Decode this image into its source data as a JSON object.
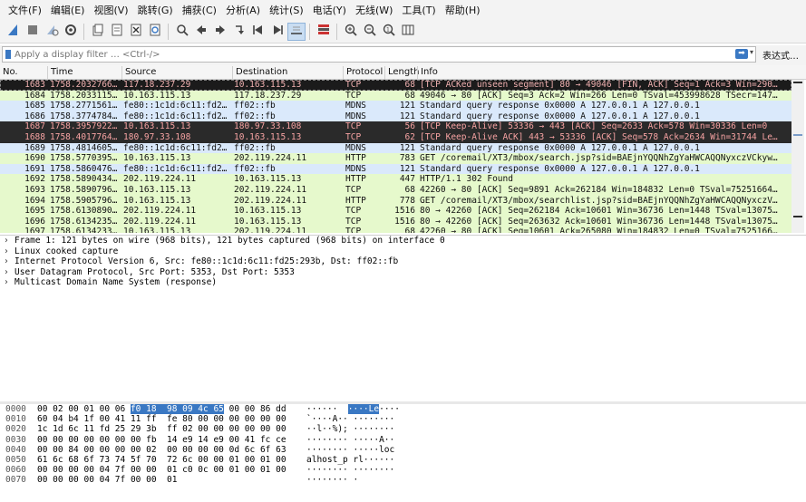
{
  "menu": [
    "文件(F)",
    "编辑(E)",
    "视图(V)",
    "跳转(G)",
    "捕获(C)",
    "分析(A)",
    "统计(S)",
    "电话(Y)",
    "无线(W)",
    "工具(T)",
    "帮助(H)"
  ],
  "toolbar_icons": [
    "shark-fin-start-icon",
    "stop-icon",
    "restart-icon",
    "options-gear-icon",
    "open-file-icon",
    "save-file-icon",
    "close-file-icon",
    "reload-icon",
    "find-icon",
    "back-arrow-icon",
    "forward-arrow-icon",
    "go-to-packet-icon",
    "first-packet-icon",
    "last-packet-icon",
    "autoscroll-icon",
    "colorize-icon",
    "zoom-in-icon",
    "zoom-out-icon",
    "normal-size-icon",
    "resize-columns-icon"
  ],
  "filter": {
    "placeholder": "Apply a display filter … <Ctrl-/>",
    "apply_arrow": "➡",
    "dropdown": "▾",
    "expression_label": "表达式…"
  },
  "columns": [
    "No.",
    "Time",
    "Source",
    "Destination",
    "Protocol",
    "Length",
    "Info"
  ],
  "colors": {
    "dark_bg": "#2a2a2a",
    "dark_fg": "#f7a3a3",
    "selected_bg": "#1b1b1b",
    "selected_fg": "#f0b0b0",
    "tcp_bg": "#e6f9cc",
    "http_bg": "#e6f9cc",
    "mdns_bg": "#dae9fb",
    "selection_blue": "#3a78c3"
  },
  "packets": [
    {
      "no": "1683",
      "time": "1758.2032766…",
      "src": "117.18.237.29",
      "dst": "10.163.115.13",
      "proto": "TCP",
      "len": "68",
      "info": "[TCP ACKed unseen segment] 80 → 49046 [FIN, ACK] Seq=1 Ack=3 Win=290…",
      "style": "selected"
    },
    {
      "no": "1684",
      "time": "1758.2033115…",
      "src": "10.163.115.13",
      "dst": "117.18.237.29",
      "proto": "TCP",
      "len": "68",
      "info": "49046 → 80 [ACK] Seq=3 Ack=2 Win=266 Len=0 TSval=453998628 TSecr=147…",
      "style": "tcp"
    },
    {
      "no": "1685",
      "time": "1758.2771561…",
      "src": "fe80::1c1d:6c11:fd2…",
      "dst": "ff02::fb",
      "proto": "MDNS",
      "len": "121",
      "info": "Standard query response 0x0000 A 127.0.0.1 A 127.0.0.1",
      "style": "mdns"
    },
    {
      "no": "1686",
      "time": "1758.3774784…",
      "src": "fe80::1c1d:6c11:fd2…",
      "dst": "ff02::fb",
      "proto": "MDNS",
      "len": "121",
      "info": "Standard query response 0x0000 A 127.0.0.1 A 127.0.0.1",
      "style": "mdns"
    },
    {
      "no": "1687",
      "time": "1758.3957922…",
      "src": "10.163.115.13",
      "dst": "180.97.33.108",
      "proto": "TCP",
      "len": "56",
      "info": "[TCP Keep-Alive] 53336 → 443 [ACK] Seq=2633 Ack=578 Win=30336 Len=0",
      "style": "dark"
    },
    {
      "no": "1688",
      "time": "1758.4017764…",
      "src": "180.97.33.108",
      "dst": "10.163.115.13",
      "proto": "TCP",
      "len": "62",
      "info": "[TCP Keep-Alive ACK] 443 → 53336 [ACK] Seq=578 Ack=2634 Win=31744 Le…",
      "style": "dark"
    },
    {
      "no": "1689",
      "time": "1758.4814605…",
      "src": "fe80::1c1d:6c11:fd2…",
      "dst": "ff02::fb",
      "proto": "MDNS",
      "len": "121",
      "info": "Standard query response 0x0000 A 127.0.0.1 A 127.0.0.1",
      "style": "mdns"
    },
    {
      "no": "1690",
      "time": "1758.5770395…",
      "src": "10.163.115.13",
      "dst": "202.119.224.11",
      "proto": "HTTP",
      "len": "783",
      "info": "GET /coremail/XT3/mbox/search.jsp?sid=BAEjnYQQNhZgYaHWCAQQNyxczVCkyw…",
      "style": "tcp"
    },
    {
      "no": "1691",
      "time": "1758.5860476…",
      "src": "fe80::1c1d:6c11:fd2…",
      "dst": "ff02::fb",
      "proto": "MDNS",
      "len": "121",
      "info": "Standard query response 0x0000 A 127.0.0.1 A 127.0.0.1",
      "style": "mdns"
    },
    {
      "no": "1692",
      "time": "1758.5890434…",
      "src": "202.119.224.11",
      "dst": "10.163.115.13",
      "proto": "HTTP",
      "len": "447",
      "info": "HTTP/1.1 302 Found",
      "style": "tcp"
    },
    {
      "no": "1693",
      "time": "1758.5890796…",
      "src": "10.163.115.13",
      "dst": "202.119.224.11",
      "proto": "TCP",
      "len": "68",
      "info": "42260 → 80 [ACK] Seq=9891 Ack=262184 Win=184832 Len=0 TSval=75251664…",
      "style": "tcp"
    },
    {
      "no": "1694",
      "time": "1758.5905796…",
      "src": "10.163.115.13",
      "dst": "202.119.224.11",
      "proto": "HTTP",
      "len": "778",
      "info": "GET /coremail/XT3/mbox/searchlist.jsp?sid=BAEjnYQQNhZgYaHWCAQQNyxczV…",
      "style": "tcp"
    },
    {
      "no": "1695",
      "time": "1758.6130890…",
      "src": "202.119.224.11",
      "dst": "10.163.115.13",
      "proto": "TCP",
      "len": "1516",
      "info": "80 → 42260 [ACK] Seq=262184 Ack=10601 Win=36736 Len=1448 TSval=13075…",
      "style": "tcp"
    },
    {
      "no": "1696",
      "time": "1758.6134235…",
      "src": "202.119.224.11",
      "dst": "10.163.115.13",
      "proto": "TCP",
      "len": "1516",
      "info": "80 → 42260 [ACK] Seq=263632 Ack=10601 Win=36736 Len=1448 TSval=13075…",
      "style": "tcp"
    },
    {
      "no": "1697",
      "time": "1758.6134233…",
      "src": "10.163.115.13",
      "dst": "202.119.224.11",
      "proto": "TCP",
      "len": "68",
      "info": "42260 → 80 [ACK] Seq=10601 Ack=265080 Win=184832 Len=0 TSval=7525166…",
      "style": "tcp"
    }
  ],
  "details": [
    "Frame 1: 121 bytes on wire (968 bits), 121 bytes captured (968 bits) on interface 0",
    "Linux cooked capture",
    "Internet Protocol Version 6, Src: fe80::1c1d:6c11:fd25:293b, Dst: ff02::fb",
    "User Datagram Protocol, Src Port: 5353, Dst Port: 5353",
    "Multicast Domain Name System (response)"
  ],
  "hexdump": [
    {
      "off": "0000",
      "pre": "00 02 00 01 00 06 ",
      "hl": "f0 18  98 09 4c 65",
      "post": " 00 00 86 dd",
      "ascii_pre": "······  ",
      "ascii_hl": "····Le",
      "ascii_post": "····"
    },
    {
      "off": "0010",
      "pre": "60 04 b4 1f 00 41 11 ff  fe 80 00 00 00 00 00 00",
      "hl": "",
      "post": "",
      "ascii_pre": "`····A·· ········",
      "ascii_hl": "",
      "ascii_post": ""
    },
    {
      "off": "0020",
      "pre": "1c 1d 6c 11 fd 25 29 3b  ff 02 00 00 00 00 00 00",
      "hl": "",
      "post": "",
      "ascii_pre": "··l··%); ········",
      "ascii_hl": "",
      "ascii_post": ""
    },
    {
      "off": "0030",
      "pre": "00 00 00 00 00 00 00 fb  14 e9 14 e9 00 41 fc ce",
      "hl": "",
      "post": "",
      "ascii_pre": "········ ·····A··",
      "ascii_hl": "",
      "ascii_post": ""
    },
    {
      "off": "0040",
      "pre": "00 00 84 00 00 00 00 02  00 00 00 00 0d 6c 6f 63",
      "hl": "",
      "post": "",
      "ascii_pre": "········ ·····loc",
      "ascii_hl": "",
      "ascii_post": ""
    },
    {
      "off": "0050",
      "pre": "61 6c 68 6f 73 74 5f 70  72 6c 00 00 01 00 01 00",
      "hl": "",
      "post": "",
      "ascii_pre": "alhost_p rl······",
      "ascii_hl": "",
      "ascii_post": ""
    },
    {
      "off": "0060",
      "pre": "00 00 00 00 04 7f 00 00  01 c0 0c 00 01 00 01 00",
      "hl": "",
      "post": "",
      "ascii_pre": "········ ········",
      "ascii_hl": "",
      "ascii_post": ""
    },
    {
      "off": "0070",
      "pre": "00 00 00 00 04 7f 00 00  01",
      "hl": "",
      "post": "",
      "ascii_pre": "········ ·",
      "ascii_hl": "",
      "ascii_post": ""
    }
  ]
}
